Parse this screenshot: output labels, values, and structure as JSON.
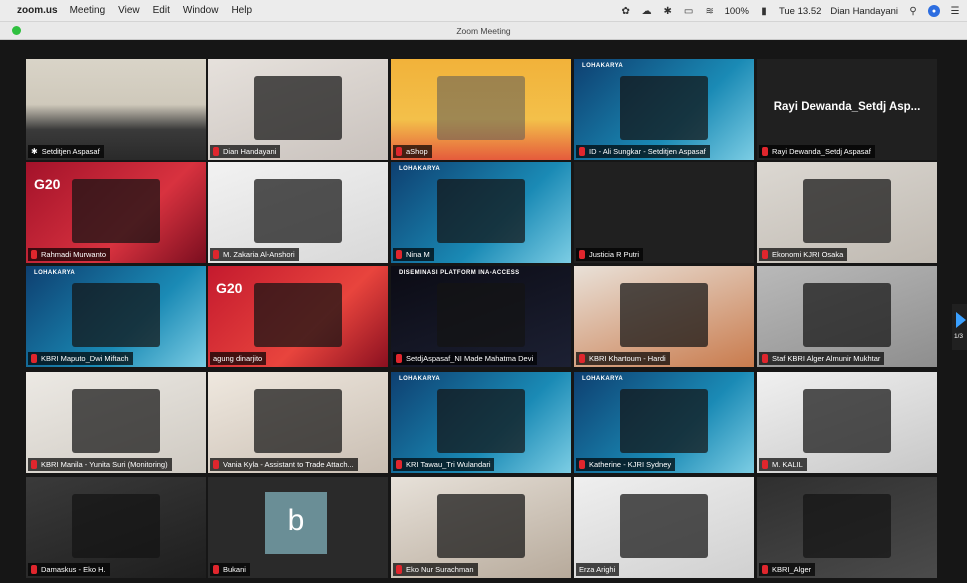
{
  "menubar": {
    "app": "zoom.us",
    "items": [
      "Meeting",
      "View",
      "Edit",
      "Window",
      "Help"
    ],
    "battery": "100%",
    "clock": "Tue 13.52",
    "user": "Dian Handayani"
  },
  "window": {
    "title": "Zoom Meeting"
  },
  "pager": {
    "label": "1/3"
  },
  "tiles": [
    {
      "name": "Setditjen Aspasaf",
      "muted": false,
      "active": true
    },
    {
      "name": "Dian Handayani",
      "muted": true
    },
    {
      "name": "aShop",
      "muted": true
    },
    {
      "name": "ID - Ali Sungkar - Setditjen Aspasaf",
      "muted": true
    },
    {
      "name": "Rayi Dewanda_Setdj Aspasaf",
      "muted": true,
      "big_name": "Rayi Dewanda_Setdj Asp..."
    },
    {
      "name": "Rahmadi Murwanto",
      "muted": true
    },
    {
      "name": "M. Zakaria Al-Anshori",
      "muted": true
    },
    {
      "name": "Nina M",
      "muted": true
    },
    {
      "name": "Justicia R Putri",
      "muted": true
    },
    {
      "name": "Ekonomi KJRI Osaka",
      "muted": true
    },
    {
      "name": "KBRI Maputo_Dwi Miftach",
      "muted": true
    },
    {
      "name": "agung dinarjito",
      "muted": false
    },
    {
      "name": "SetdjAspasaf_NI Made Mahatma Devi",
      "muted": true
    },
    {
      "name": "KBRI Khartoum - Hardi",
      "muted": true
    },
    {
      "name": "Staf KBRI Alger Almunir Mukhtar",
      "muted": true
    },
    {
      "name": "KBRI Manila - Yunita Suri (Monitoring)",
      "muted": true
    },
    {
      "name": "Vania Kyla - Assistant to Trade Attach...",
      "muted": true
    },
    {
      "name": "KRI Tawau_Tri Wulandari",
      "muted": true
    },
    {
      "name": "Katherine - KJRI Sydney",
      "muted": true
    },
    {
      "name": "M. KALIL",
      "muted": true
    },
    {
      "name": "Damaskus - Eko H.",
      "muted": true
    },
    {
      "name": "Bukani",
      "muted": true,
      "avatar_letter": "b"
    },
    {
      "name": "Eko Nur Surachman",
      "muted": true
    },
    {
      "name": "Erza Arighi",
      "muted": false
    },
    {
      "name": "KBRI_Alger",
      "muted": true
    }
  ],
  "slides": {
    "lohakarya": "LOHAKARYA",
    "diseminasi": "DISEMINASI PLATFORM INA-ACCESS",
    "g20": "G20"
  }
}
